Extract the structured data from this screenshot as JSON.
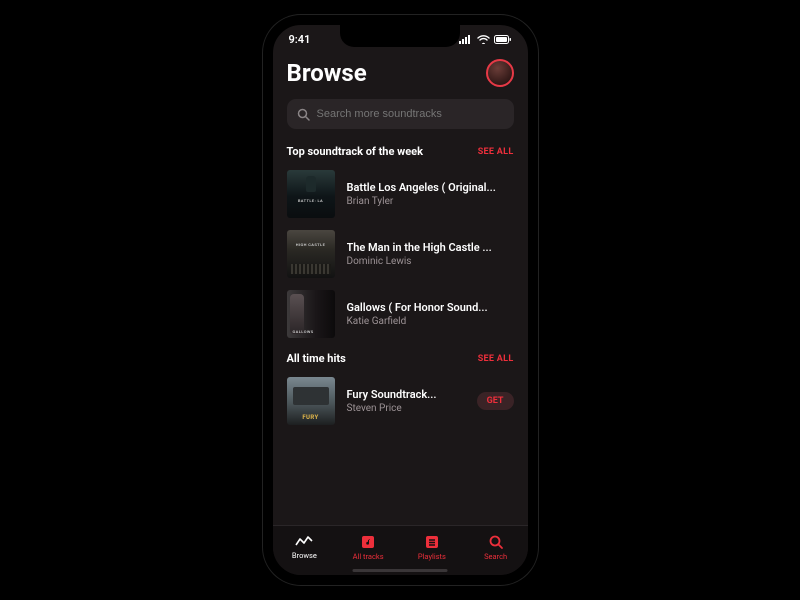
{
  "status": {
    "time": "9:41"
  },
  "colors": {
    "accent": "#ed2f3b",
    "bg": "#1b1718"
  },
  "header": {
    "title": "Browse"
  },
  "search": {
    "placeholder": "Search more soundtracks"
  },
  "sections": [
    {
      "title": "Top soundtrack of the week",
      "see_all": "SEE ALL",
      "tracks": [
        {
          "title": "Battle Los Angeles ( Original...",
          "artist": "Brian Tyler",
          "art_label": "BATTLE: LA"
        },
        {
          "title": "The Man in the High Castle ...",
          "artist": "Dominic Lewis",
          "art_label": "HIGH CASTLE"
        },
        {
          "title": "Gallows ( For Honor Sound...",
          "artist": "Katie Garfield",
          "art_label": "GALLOWS"
        }
      ]
    },
    {
      "title": "All time hits",
      "see_all": "SEE ALL",
      "tracks": [
        {
          "title": "Fury Soundtrack...",
          "artist": "Steven Price",
          "art_label": "FURY",
          "cta": "GET"
        }
      ]
    }
  ],
  "tabs": [
    {
      "label": "Browse",
      "icon": "chart",
      "active": true
    },
    {
      "label": "All tracks",
      "icon": "music",
      "active": false
    },
    {
      "label": "Playlists",
      "icon": "list",
      "active": false
    },
    {
      "label": "Search",
      "icon": "search",
      "active": false
    }
  ]
}
